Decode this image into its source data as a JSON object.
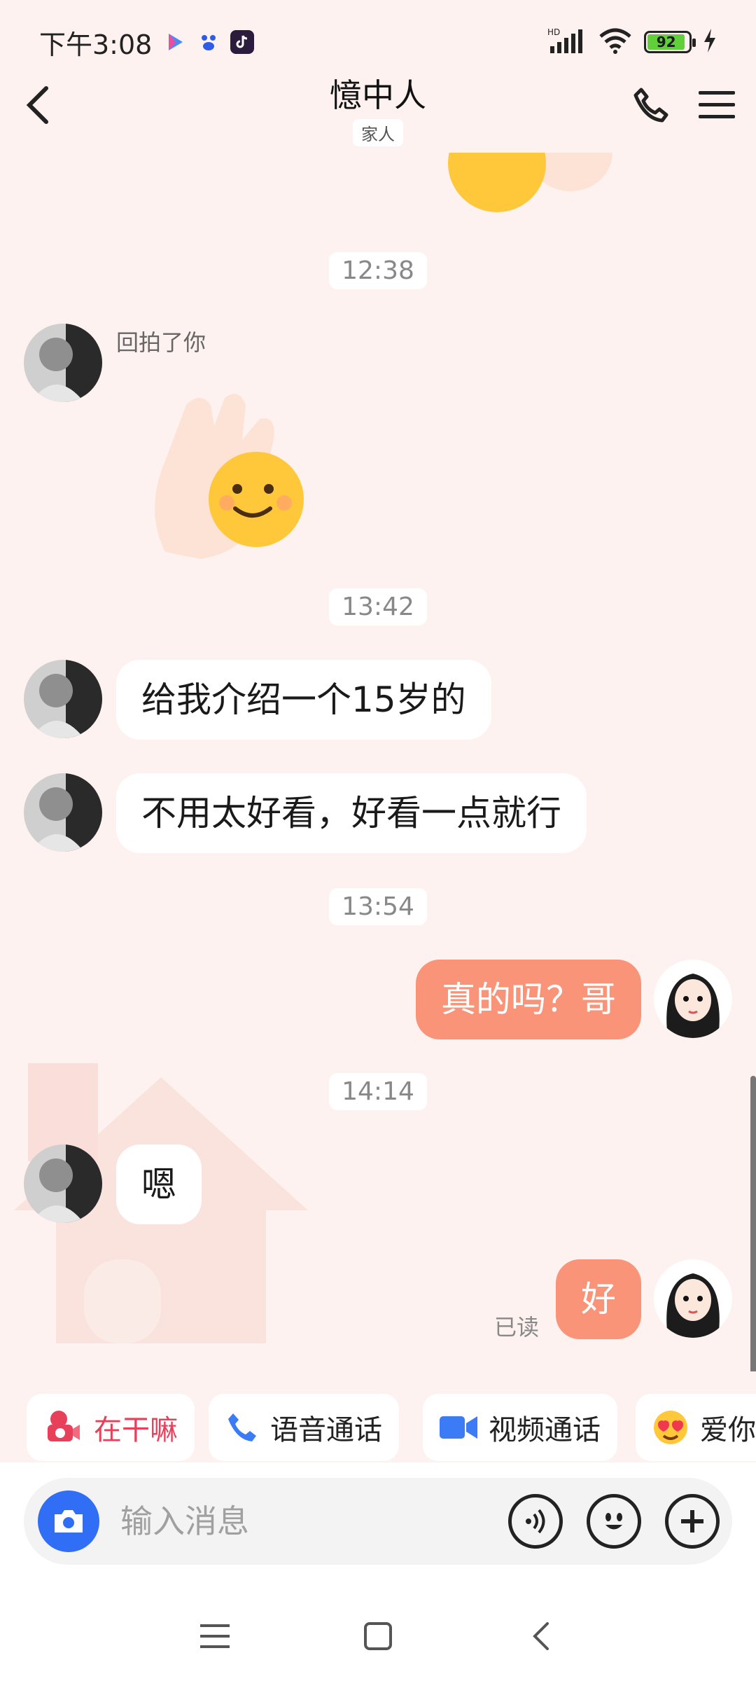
{
  "status": {
    "time": "下午3:08",
    "battery": "92",
    "network": "HD"
  },
  "header": {
    "title": "憶中人",
    "tag": "家人"
  },
  "messages": [
    {
      "type": "time",
      "text": "12:38"
    },
    {
      "type": "pat",
      "from": "contact",
      "text": "回拍了你"
    },
    {
      "type": "time",
      "text": "13:42"
    },
    {
      "type": "text",
      "from": "contact",
      "text": "给我介绍一个15岁的"
    },
    {
      "type": "text",
      "from": "contact",
      "text": "不用太好看，好看一点就行"
    },
    {
      "type": "time",
      "text": "13:54"
    },
    {
      "type": "text",
      "from": "me",
      "text": "真的吗？哥"
    },
    {
      "type": "time",
      "text": "14:14"
    },
    {
      "type": "text",
      "from": "contact",
      "text": "嗯"
    },
    {
      "type": "text",
      "from": "me",
      "text": "好",
      "status": "已读"
    }
  ],
  "quick_actions": [
    {
      "label": "在干嘛",
      "icon": "camera-heart-icon",
      "color": "#e8405a"
    },
    {
      "label": "语音通话",
      "icon": "phone-icon",
      "color": "#3b7cf6"
    },
    {
      "label": "视频通话",
      "icon": "video-icon",
      "color": "#3b7cf6"
    },
    {
      "label": "爱你",
      "icon": "heart-eyes-emoji-icon",
      "color": "#222222"
    }
  ],
  "input": {
    "placeholder": "输入消息"
  },
  "colors": {
    "outgoing_bubble": "#fa9479",
    "camera_button": "#2f6ef5",
    "background": "#fdf2ef"
  }
}
